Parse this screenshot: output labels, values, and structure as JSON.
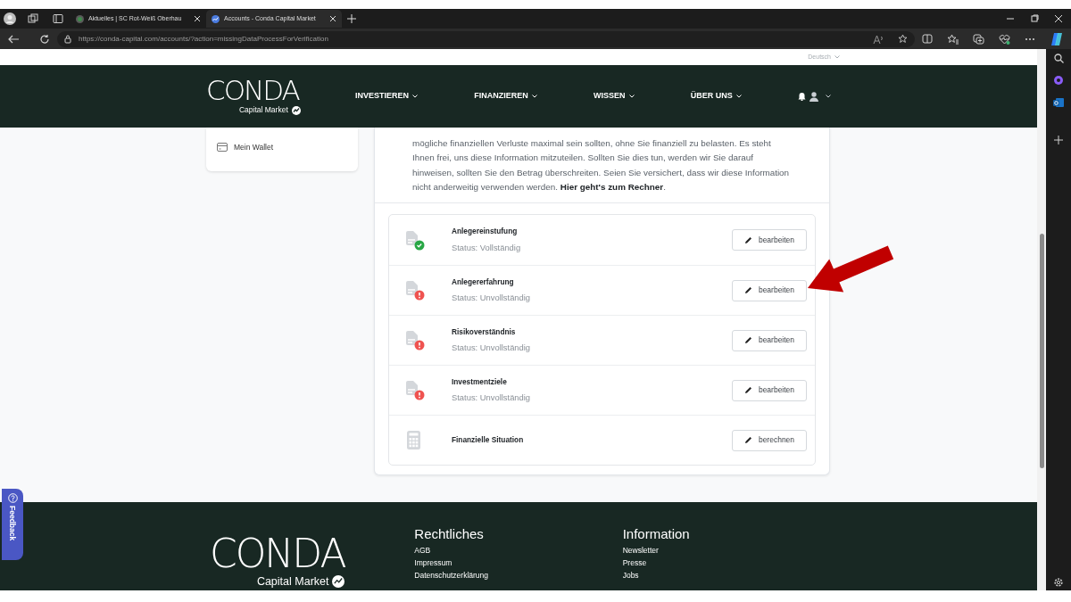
{
  "browser": {
    "tabs": [
      {
        "title": "Aktuelles | SC Rot-Weiß Oberhau",
        "selected": false
      },
      {
        "title": "Accounts - Conda Capital Market",
        "selected": true
      }
    ],
    "url": "https://conda-capital.com/accounts/?action=missingDataProcessForVerification"
  },
  "language": "Deutsch",
  "logo": {
    "wordmark": "CONDA",
    "tagline": "Capital Market"
  },
  "nav": [
    "INVESTIEREN",
    "FINANZIEREN",
    "WISSEN",
    "ÜBER UNS"
  ],
  "sidebar": {
    "items": [
      {
        "label": "Mein Wallet"
      }
    ]
  },
  "intro": {
    "text": "mögliche finanziellen Verluste maximal sein sollten, ohne Sie finanziell zu belasten. Es steht Ihnen frei, uns diese Information mitzuteilen. Sollten Sie dies tun, werden wir Sie darauf hinweisen, sollten Sie den Betrag überschreiten. Seien Sie versichert, dass wir diese Information nicht anderweitig verwenden werden. ",
    "link": "Hier geht's zum Rechner",
    "end": "."
  },
  "steps": [
    {
      "kind": "document",
      "title": "Anlegereinstufung",
      "status": "Status: Vollständig",
      "complete": true,
      "button": "bearbeiten"
    },
    {
      "kind": "document",
      "title": "Anlegererfahrung",
      "status": "Status: Unvollständig",
      "complete": false,
      "button": "bearbeiten"
    },
    {
      "kind": "document",
      "title": "Risikoverständnis",
      "status": "Status: Unvollständig",
      "complete": false,
      "button": "bearbeiten"
    },
    {
      "kind": "document",
      "title": "Investmentziele",
      "status": "Status: Unvollständig",
      "complete": false,
      "button": "bearbeiten"
    },
    {
      "kind": "calculator",
      "title": "Finanzielle Situation",
      "button": "berechnen"
    }
  ],
  "footer": {
    "columns": [
      {
        "heading": "Rechtliches",
        "links": [
          "AGB",
          "Impressum",
          "Datenschutzerklärung"
        ]
      },
      {
        "heading": "Information",
        "links": [
          "Newsletter",
          "Presse",
          "Jobs"
        ]
      }
    ]
  },
  "footer_logo": {
    "wordmark": "CONDA",
    "tagline": "Capital Market"
  },
  "feedback": "Feedback"
}
